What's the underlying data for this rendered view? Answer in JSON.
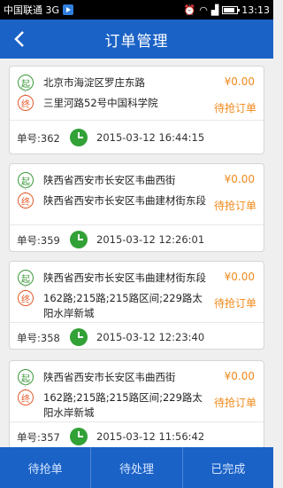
{
  "status_bar": {
    "carrier": "中国联通 3G",
    "time": "13:13",
    "icons": [
      "alarm-icon",
      "wifi-icon",
      "signal-icon",
      "battery-icon"
    ]
  },
  "header": {
    "back_icon": "back-icon",
    "title": "订单管理"
  },
  "orders": [
    {
      "start_badge": "起",
      "end_badge": "终",
      "from": "北京市海淀区罗庄东路",
      "to": "三里河路52号中国科学院",
      "price": "¥0.00",
      "status": "待抢订单",
      "order_no": "单号:362",
      "datetime": "2015-03-12 16:44:15"
    },
    {
      "start_badge": "起",
      "end_badge": "终",
      "from": "陕西省西安市长安区韦曲西街",
      "to": "陕西省西安市长安区韦曲建材街东段",
      "price": "¥0.00",
      "status": "待抢订单",
      "order_no": "单号:359",
      "datetime": "2015-03-12 12:26:01"
    },
    {
      "start_badge": "起",
      "end_badge": "终",
      "from": "陕西省西安市长安区韦曲建材街东段",
      "to": "162路;215路;215路区间;229路太阳水岸新城",
      "price": "¥0.00",
      "status": "待抢订单",
      "order_no": "单号:358",
      "datetime": "2015-03-12 12:23:40"
    },
    {
      "start_badge": "起",
      "end_badge": "终",
      "from": "陕西省西安市长安区韦曲西街",
      "to": "162路;215路;215路区间;229路太阳水岸新城",
      "price": "¥0.00",
      "status": "待抢订单",
      "order_no": "单号:357",
      "datetime": "2015-03-12 11:56:42"
    }
  ],
  "tabs": [
    "待抢单",
    "待处理",
    "已完成"
  ],
  "colors": {
    "primary": "#1b62c6",
    "accent": "#f08a1c",
    "start": "#3a9a3a",
    "end": "#e35a2c",
    "clock": "#32a136"
  }
}
